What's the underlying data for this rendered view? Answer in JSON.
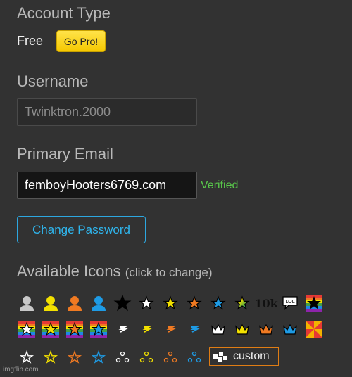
{
  "account": {
    "heading": "Account Type",
    "tier": "Free",
    "upgrade_label": "Go Pro!"
  },
  "username": {
    "heading": "Username",
    "value": "Twinktron.2000"
  },
  "email": {
    "heading": "Primary Email",
    "value": "femboyHooters6769.com",
    "status": "Verified"
  },
  "password": {
    "button_label": "Change Password"
  },
  "icons": {
    "heading": "Available Icons",
    "hint": "(click to change)",
    "badge_10k": "10k",
    "badge_lol": "LOL",
    "custom_label": "custom"
  },
  "colors": {
    "background": "#323232",
    "accent_yellow": "#f5c800",
    "link_blue": "#2fb6ee",
    "verified_green": "#59c84b",
    "custom_orange": "#e07d14"
  },
  "watermark": "imgflip.com"
}
